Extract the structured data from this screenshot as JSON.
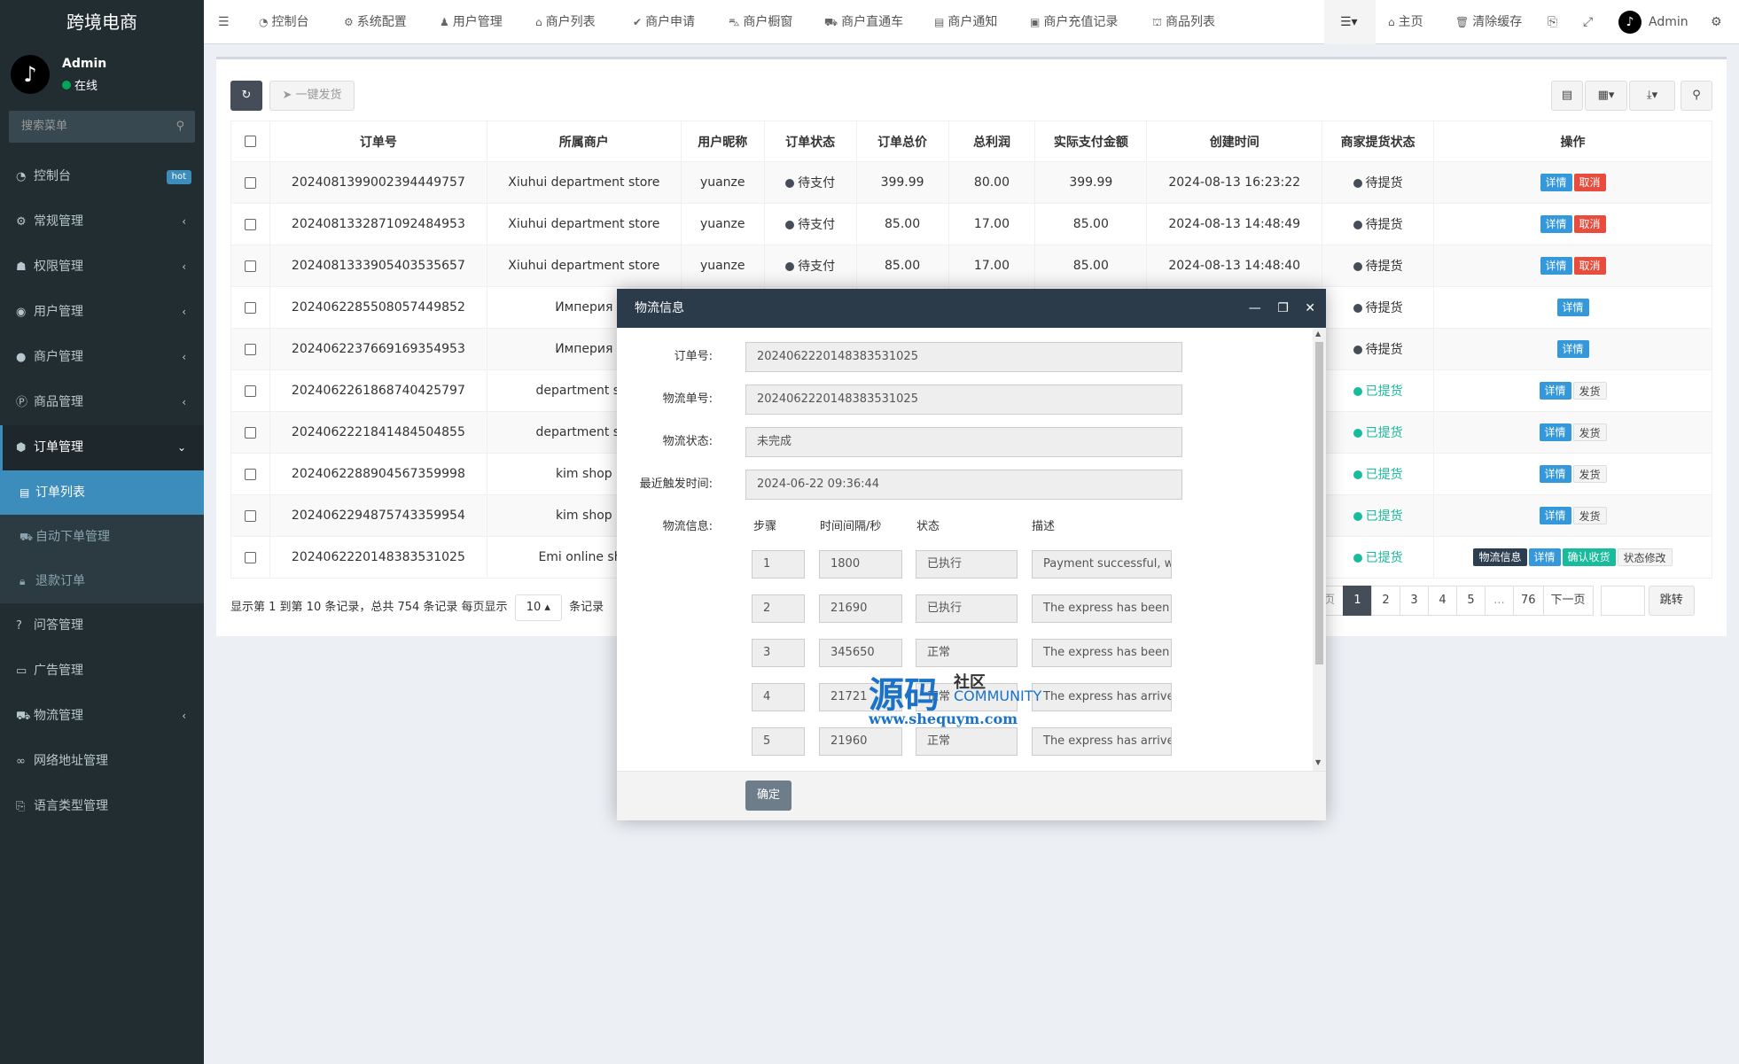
{
  "app": {
    "title": "跨境电商"
  },
  "user": {
    "name": "Admin",
    "status": "在线"
  },
  "sidebar": {
    "search_placeholder": "搜索菜单",
    "items": [
      {
        "label": "控制台",
        "icon": "dashboard-icon",
        "badge": "hot"
      },
      {
        "label": "常规管理",
        "icon": "cogs-icon"
      },
      {
        "label": "权限管理",
        "icon": "group-icon"
      },
      {
        "label": "用户管理",
        "icon": "user-circle-icon"
      },
      {
        "label": "商户管理",
        "icon": "apple-icon"
      },
      {
        "label": "商品管理",
        "icon": "product-icon"
      },
      {
        "label": "订单管理",
        "icon": "order-icon"
      }
    ],
    "submenu": [
      {
        "label": "订单列表",
        "icon": "list-icon"
      },
      {
        "label": "自动下单管理",
        "icon": "car-icon"
      },
      {
        "label": "退款订单",
        "icon": "lock-icon"
      }
    ],
    "items_after": [
      {
        "label": "问答管理",
        "icon": "question-icon"
      },
      {
        "label": "广告管理",
        "icon": "ad-icon"
      },
      {
        "label": "物流管理",
        "icon": "truck-icon"
      },
      {
        "label": "网络地址管理",
        "icon": "link-icon"
      },
      {
        "label": "语言类型管理",
        "icon": "language-icon"
      }
    ]
  },
  "navbar": {
    "tabs": [
      {
        "label": "控制台",
        "icon": "dashboard-icon"
      },
      {
        "label": "系统配置",
        "icon": "gear-icon"
      },
      {
        "label": "用户管理",
        "icon": "user-icon"
      },
      {
        "label": "商户列表",
        "icon": "home-icon"
      },
      {
        "label": "商户申请",
        "icon": "check-icon"
      },
      {
        "label": "商户橱窗",
        "icon": "cart-icon"
      },
      {
        "label": "商户直通车",
        "icon": "car-icon"
      },
      {
        "label": "商户通知",
        "icon": "notice-icon"
      },
      {
        "label": "商户充值记录",
        "icon": "money-icon"
      },
      {
        "label": "商品列表",
        "icon": "shop-icon"
      }
    ],
    "home": "主页",
    "clear_cache": "清除缓存",
    "admin": "Admin"
  },
  "toolbar": {
    "ship_all": "一键发货"
  },
  "table": {
    "columns": [
      "订单号",
      "所属商户",
      "用户昵称",
      "订单状态",
      "订单总价",
      "总利润",
      "实际支付金额",
      "创建时间",
      "商家提货状态",
      "操作"
    ],
    "rows": [
      {
        "order_no": "2024081399002394449757",
        "merchant": "Xiuhui department store",
        "nick": "yuanze",
        "status": "待支付",
        "total": "399.99",
        "profit": "80.00",
        "paid": "399.99",
        "created": "2024-08-13 16:23:22",
        "pickup": "待提货",
        "actions": [
          "详情",
          "取消"
        ]
      },
      {
        "order_no": "2024081332871092484953",
        "merchant": "Xiuhui department store",
        "nick": "yuanze",
        "status": "待支付",
        "total": "85.00",
        "profit": "17.00",
        "paid": "85.00",
        "created": "2024-08-13 14:48:49",
        "pickup": "待提货",
        "actions": [
          "详情",
          "取消"
        ]
      },
      {
        "order_no": "2024081333905403535657",
        "merchant": "Xiuhui department store",
        "nick": "yuanze",
        "status": "待支付",
        "total": "85.00",
        "profit": "17.00",
        "paid": "85.00",
        "created": "2024-08-13 14:48:40",
        "pickup": "待提货",
        "actions": [
          "详情",
          "取消"
        ]
      },
      {
        "order_no": "2024062285508057449852",
        "merchant": "Империя",
        "nick": "",
        "status": "",
        "total": "",
        "profit": "",
        "paid": "",
        "created": "",
        "pickup": "待提货",
        "actions": [
          "详情"
        ]
      },
      {
        "order_no": "2024062237669169354953",
        "merchant": "Империя",
        "nick": "",
        "status": "",
        "total": "",
        "profit": "",
        "paid": "",
        "created": "",
        "pickup": "待提货",
        "actions": [
          "详情"
        ]
      },
      {
        "order_no": "2024062261868740425797",
        "merchant": "department sto",
        "nick": "",
        "status": "",
        "total": "",
        "profit": "",
        "paid": "",
        "created": "",
        "pickup": "已提货",
        "actions": [
          "详情",
          "发货"
        ]
      },
      {
        "order_no": "2024062221841484504855",
        "merchant": "department sto",
        "nick": "",
        "status": "",
        "total": "",
        "profit": "",
        "paid": "",
        "created": "",
        "pickup": "已提货",
        "actions": [
          "详情",
          "发货"
        ]
      },
      {
        "order_no": "2024062288904567359998",
        "merchant": "kim shop",
        "nick": "",
        "status": "",
        "total": "",
        "profit": "",
        "paid": "",
        "created": "",
        "pickup": "已提货",
        "actions": [
          "详情",
          "发货"
        ]
      },
      {
        "order_no": "2024062294875743359954",
        "merchant": "kim shop",
        "nick": "",
        "status": "",
        "total": "",
        "profit": "",
        "paid": "",
        "created": "",
        "pickup": "已提货",
        "actions": [
          "详情",
          "发货"
        ]
      },
      {
        "order_no": "2024062220148383531025",
        "merchant": "Emi online sho",
        "nick": "",
        "status": "",
        "total": "",
        "profit": "",
        "paid": "",
        "created": "",
        "pickup": "已提货",
        "actions": [
          "物流信息",
          "详情",
          "确认收货",
          "状态修改"
        ]
      }
    ]
  },
  "pager": {
    "info_prefix": "显示第 1 到第 10 条记录，总共 754 条记录 每页显示",
    "page_size": "10",
    "info_suffix": "条记录",
    "prev": "页",
    "pages": [
      "1",
      "2",
      "3",
      "4",
      "5",
      "...",
      "76"
    ],
    "next": "下一页",
    "jump": "跳转"
  },
  "modal": {
    "title": "物流信息",
    "labels": {
      "order_no": "订单号:",
      "tracking_no": "物流单号:",
      "status": "物流状态:",
      "last_time": "最近触发时间:",
      "info": "物流信息:"
    },
    "values": {
      "order_no": "2024062220148383531025",
      "tracking_no": "2024062220148383531025",
      "status": "未完成",
      "last_time": "2024-06-22 09:36:44"
    },
    "log_columns": [
      "步骤",
      "时间间隔/秒",
      "状态",
      "描述"
    ],
    "log_rows": [
      {
        "step": "1",
        "interval": "1800",
        "status": "已执行",
        "desc": "Payment successful, waiting"
      },
      {
        "step": "2",
        "interval": "21690",
        "status": "已执行",
        "desc": "The express has been"
      },
      {
        "step": "3",
        "interval": "345650",
        "status": "正常",
        "desc": "The express has been"
      },
      {
        "step": "4",
        "interval": "21721",
        "status": "正常",
        "desc": "The express has arrive"
      },
      {
        "step": "5",
        "interval": "21960",
        "status": "正常",
        "desc": "The express has arrive"
      }
    ],
    "ok": "确定"
  },
  "watermark": {
    "big": "源码",
    "small1": "社区",
    "small2": "COMMUNITY",
    "url": "www.shequym.com"
  },
  "colors": {
    "sidebar_bg": "#222d32",
    "active": "#3c8dbc",
    "blue_btn": "#3498db",
    "red_btn": "#e74c3c",
    "green_status": "#18bc9c",
    "modal_head": "#2c3b4a"
  }
}
